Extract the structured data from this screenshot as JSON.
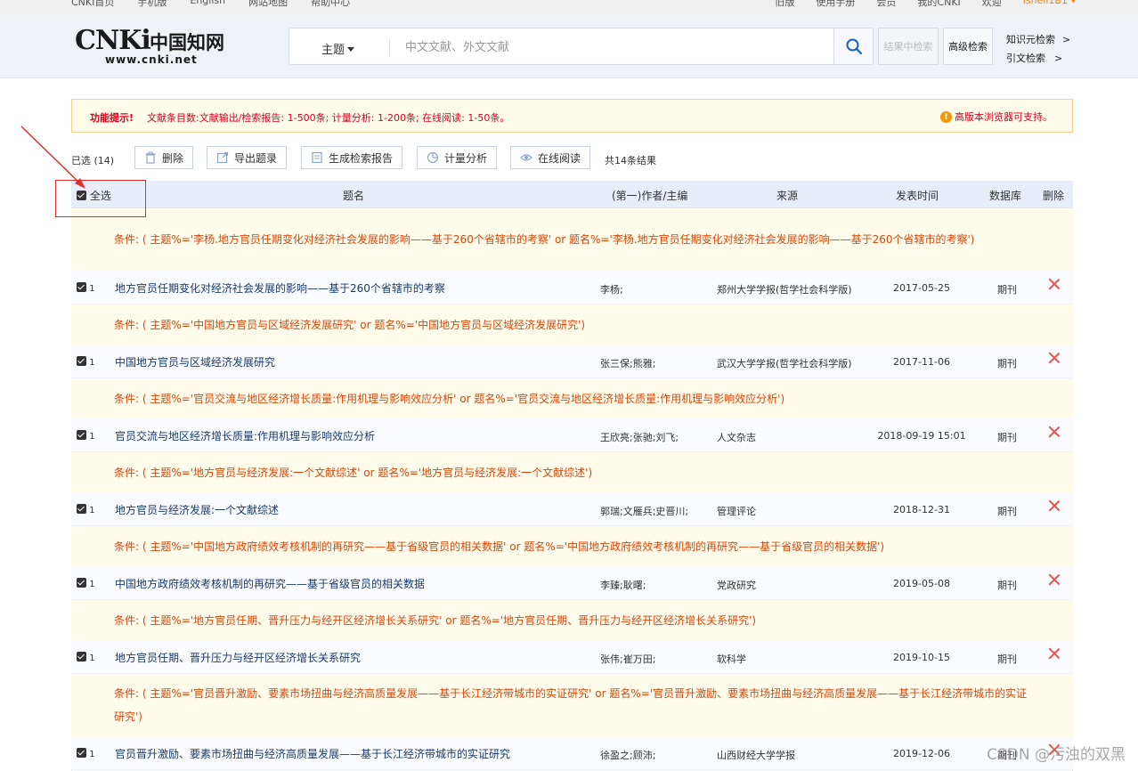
{
  "topbar": {
    "left": [
      "CNKI首页",
      "手机版",
      "English",
      "网站地图",
      "帮助中心"
    ],
    "right": [
      "旧版",
      "使用手册",
      "会员",
      "我的CNKI",
      "欢迎",
      "ishell1B1 ▾"
    ]
  },
  "header": {
    "logo_main": "CNKi",
    "logo_cn": "中国知网",
    "logo_url": "www.cnki.net",
    "search_field": "主题",
    "search_placeholder": "中文文献、外文文献",
    "btn_result_search": "结果中检索",
    "btn_advanced": "高级检索",
    "link_knowledge": "知识元检索",
    "link_citation": "引文检索",
    "link_arrow": ">"
  },
  "notice": {
    "label": "功能提示!",
    "text": "文献条目数:文献输出/检索报告: 1-500条; 计量分析: 1-200条; 在线阅读: 1-50条。",
    "right": "高版本浏览器可支持。",
    "right_icon": "!"
  },
  "toolbar": {
    "selected": "已选 (14)",
    "delete": "删除",
    "export": "导出题录",
    "report": "生成检索报告",
    "analysis": "计量分析",
    "read": "在线阅读",
    "total": "共14条结果"
  },
  "table": {
    "headers": {
      "select_all": "全选",
      "title": "题名",
      "author": "(第一)作者/主编",
      "source": "来源",
      "date": "发表时间",
      "db": "数据库",
      "del": "删除"
    }
  },
  "groups": [
    {
      "cond": "条件: ( 主题%='李杨.地方官员任期变化对经济社会发展的影响——基于260个省辖市的考察' or 题名%='李杨.地方官员任期变化对经济社会发展的影响——基于260个省辖市的考察')",
      "num": "1",
      "title": "地方官员任期变化对经济社会发展的影响——基于260个省辖市的考察",
      "author": "李杨;",
      "source": "郑州大学学报(哲学社会科学版)",
      "date": "2017-05-25",
      "db": "期刊"
    },
    {
      "cond": "条件: ( 主题%='中国地方官员与区域经济发展研究' or 题名%='中国地方官员与区域经济发展研究')",
      "num": "1",
      "title": "中国地方官员与区域经济发展研究",
      "author": "张三保;熊雅;",
      "source": "武汉大学学报(哲学社会科学版)",
      "date": "2017-11-06",
      "db": "期刊"
    },
    {
      "cond": "条件: ( 主题%='官员交流与地区经济增长质量:作用机理与影响效应分析' or 题名%='官员交流与地区经济增长质量:作用机理与影响效应分析')",
      "num": "1",
      "title": "官员交流与地区经济增长质量:作用机理与影响效应分析",
      "author": "王欣亮;张驰;刘飞;",
      "source": "人文杂志",
      "date": "2018-09-19 15:01",
      "db": "期刊"
    },
    {
      "cond": "条件: ( 主题%='地方官员与经济发展:一个文献综述' or 题名%='地方官员与经济发展:一个文献综述')",
      "num": "1",
      "title": "地方官员与经济发展:一个文献综述",
      "author": "郭瑞;文雁兵;史晋川;",
      "source": "管理评论",
      "date": "2018-12-31",
      "db": "期刊"
    },
    {
      "cond": "条件: ( 主题%='中国地方政府绩效考核机制的再研究——基于省级官员的相关数据' or 题名%='中国地方政府绩效考核机制的再研究——基于省级官员的相关数据')",
      "num": "1",
      "title": "中国地方政府绩效考核机制的再研究——基于省级官员的相关数据",
      "author": "李臻;耿曙;",
      "source": "党政研究",
      "date": "2019-05-08",
      "db": "期刊"
    },
    {
      "cond": "条件: ( 主题%='地方官员任期、晋升压力与经开区经济增长关系研究' or 题名%='地方官员任期、晋升压力与经开区经济增长关系研究')",
      "num": "1",
      "title": "地方官员任期、晋升压力与经开区经济增长关系研究",
      "author": "张伟;崔万田;",
      "source": "软科学",
      "date": "2019-10-15",
      "db": "期刊"
    },
    {
      "cond": "条件: ( 主题%='官员晋升激励、要素市场扭曲与经济高质量发展——基于长江经济带城市的实证研究' or 题名%='官员晋升激励、要素市场扭曲与经济高质量发展——基于长江经济带城市的实证研究')",
      "num": "1",
      "title": "官员晋升激励、要素市场扭曲与经济高质量发展——基于长江经济带城市的实证研究",
      "author": "徐盈之;顾沛;",
      "source": "山西财经大学学报",
      "date": "2019-12-06",
      "db": "期刊"
    }
  ],
  "watermark": "CSDN @污浊的双黑",
  "colors": {
    "accent": "#1b5fbf",
    "condition": "#d9470a",
    "notice_red": "#d9001b",
    "highlight_box": "#e52b2b",
    "delete_x": "#e8504b"
  }
}
